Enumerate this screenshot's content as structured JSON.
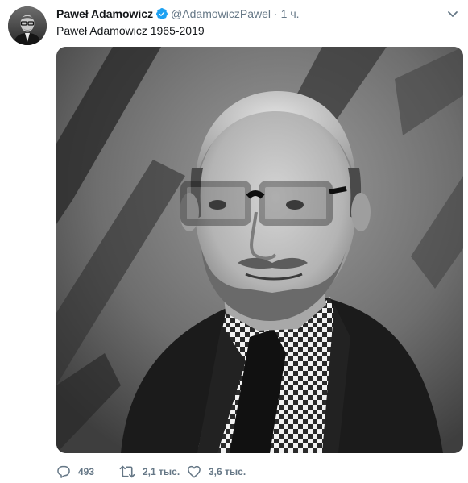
{
  "tweet": {
    "author_name": "Paweł Adamowicz",
    "handle": "@AdamowiczPawel",
    "separator": "·",
    "time": "1 ч.",
    "text": "Paweł Adamowicz 1965-2019"
  },
  "actions": {
    "replies": "493",
    "retweets": "2,1 тыс.",
    "likes": "3,6 тыс."
  },
  "icons": {
    "verified": "verified-badge-icon",
    "caret": "chevron-down-icon",
    "reply": "reply-icon",
    "retweet": "retweet-icon",
    "like": "heart-icon"
  },
  "colors": {
    "text": "#14171a",
    "secondary": "#657786",
    "verified": "#1da1f2"
  }
}
